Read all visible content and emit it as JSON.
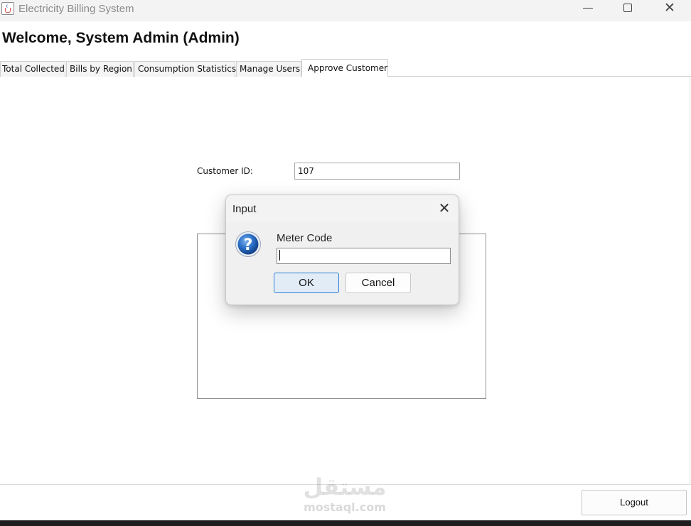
{
  "window": {
    "title": "Electricity Billing System",
    "controls": {
      "minimize_icon": "minimize-icon",
      "maximize_icon": "maximize-icon",
      "close_icon": "close-icon",
      "close_glyph": "✕"
    }
  },
  "header": {
    "welcome": "Welcome, System Admin (Admin)"
  },
  "tabs": [
    {
      "label": "Total Collected",
      "selected": false
    },
    {
      "label": "Bills by Region",
      "selected": false
    },
    {
      "label": "Consumption Statistics",
      "selected": false
    },
    {
      "label": "Manage Users",
      "selected": false
    },
    {
      "label": "Approve Customer",
      "selected": true
    }
  ],
  "approve_panel": {
    "customer_id_label": "Customer ID:",
    "customer_id_value": "107"
  },
  "dialog": {
    "title": "Input",
    "close_glyph": "✕",
    "icon": "question-icon",
    "prompt": "Meter Code",
    "input_value": "",
    "ok_label": "OK",
    "cancel_label": "Cancel"
  },
  "footer": {
    "logout_label": "Logout"
  },
  "watermark": {
    "arabic": "مستقل",
    "latin": "mostaql.com"
  },
  "colors": {
    "accent_border": "#2f7fd1",
    "ok_fill": "#e1ecf7",
    "question_icon_blue": "#1f5fb4"
  }
}
